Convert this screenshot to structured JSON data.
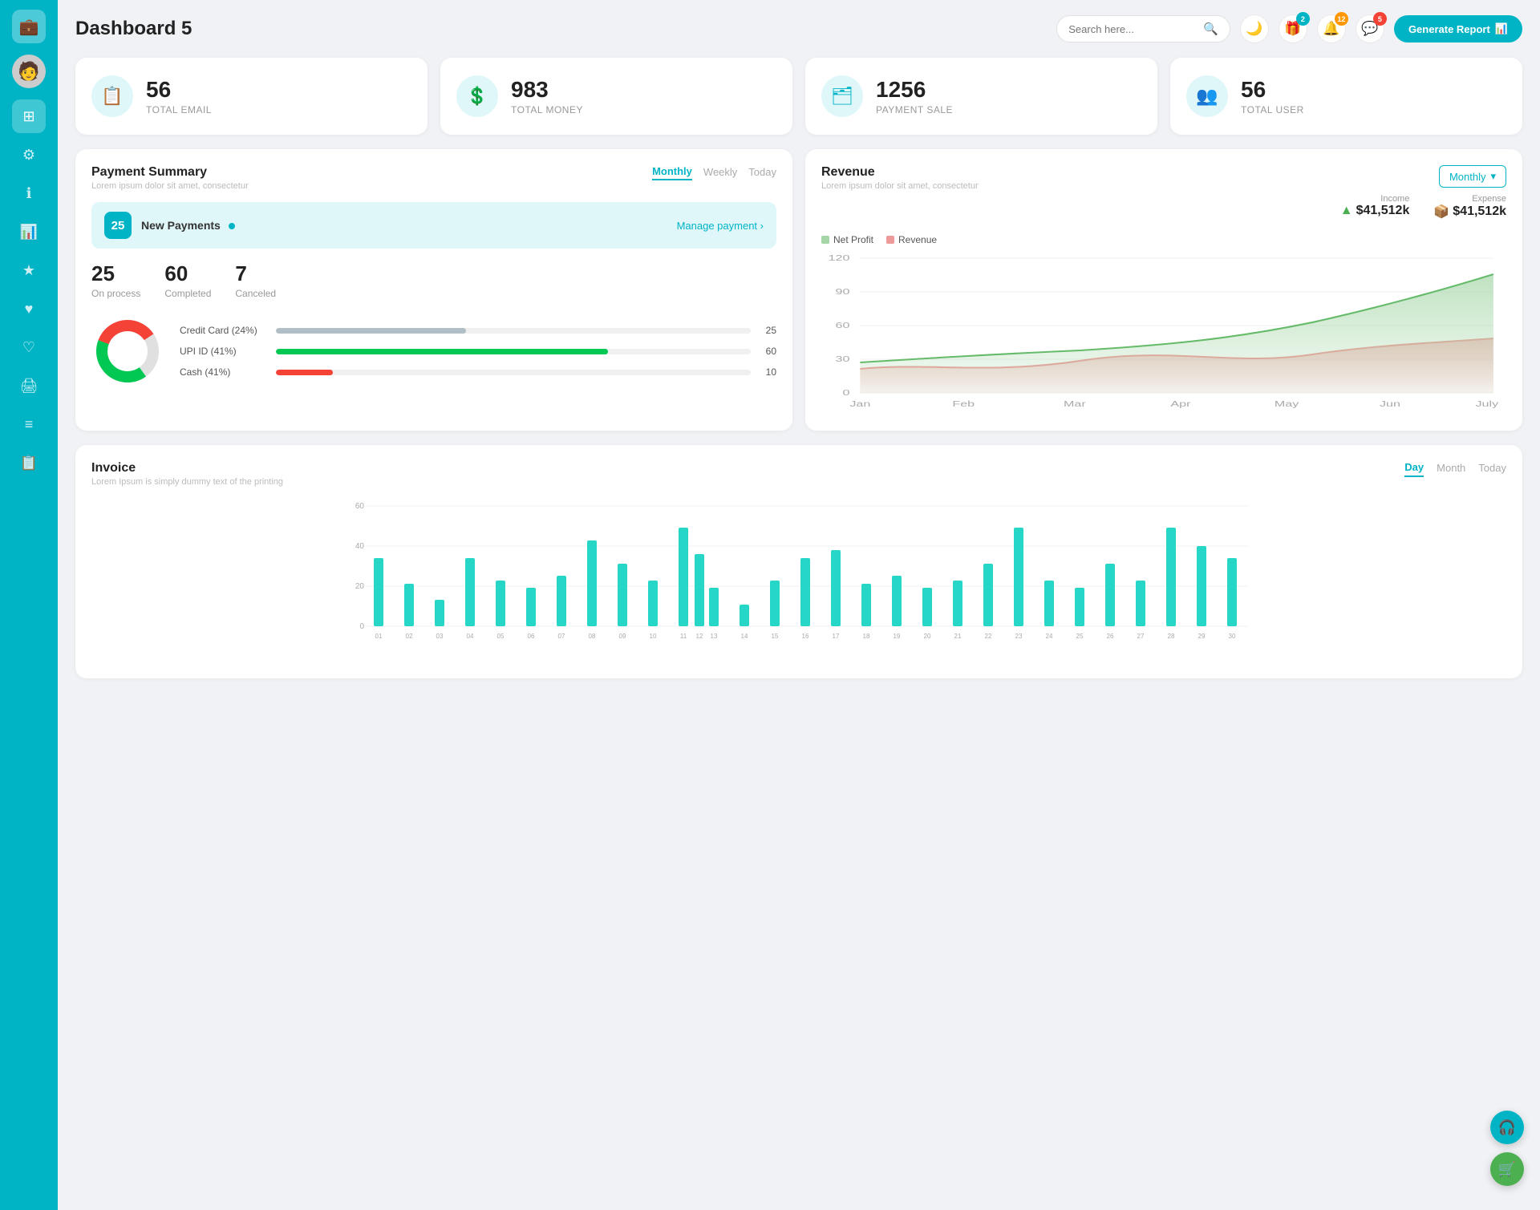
{
  "sidebar": {
    "logo_icon": "💼",
    "nav_items": [
      {
        "icon": "👤",
        "name": "avatar",
        "active": false
      },
      {
        "icon": "⊞",
        "name": "dashboard",
        "active": true
      },
      {
        "icon": "⚙",
        "name": "settings",
        "active": false
      },
      {
        "icon": "ℹ",
        "name": "info",
        "active": false
      },
      {
        "icon": "📊",
        "name": "analytics",
        "active": false
      },
      {
        "icon": "★",
        "name": "favorites",
        "active": false
      },
      {
        "icon": "♥",
        "name": "likes",
        "active": false
      },
      {
        "icon": "♡",
        "name": "wishlist",
        "active": false
      },
      {
        "icon": "🖨",
        "name": "print",
        "active": false
      },
      {
        "icon": "≡",
        "name": "menu",
        "active": false
      },
      {
        "icon": "📋",
        "name": "list",
        "active": false
      }
    ]
  },
  "header": {
    "title": "Dashboard 5",
    "search_placeholder": "Search here...",
    "generate_btn": "Generate Report",
    "badges": {
      "gift": "2",
      "bell": "12",
      "chat": "5"
    }
  },
  "stats": [
    {
      "number": "56",
      "label": "TOTAL EMAIL",
      "icon": "📋"
    },
    {
      "number": "983",
      "label": "TOTAL MONEY",
      "icon": "💲"
    },
    {
      "number": "1256",
      "label": "PAYMENT SALE",
      "icon": "🗂"
    },
    {
      "number": "56",
      "label": "TOTAL USER",
      "icon": "👥"
    }
  ],
  "payment_summary": {
    "title": "Payment Summary",
    "subtitle": "Lorem ipsum dolor sit amet, consectetur",
    "tabs": [
      "Monthly",
      "Weekly",
      "Today"
    ],
    "active_tab": "Monthly",
    "new_payments_count": "25",
    "new_payments_label": "New Payments",
    "manage_link": "Manage payment",
    "stats": [
      {
        "value": "25",
        "label": "On process"
      },
      {
        "value": "60",
        "label": "Completed"
      },
      {
        "value": "7",
        "label": "Canceled"
      }
    ],
    "bars": [
      {
        "label": "Credit Card (24%)",
        "fill": "#b0bec5",
        "percent": 40,
        "value": "25"
      },
      {
        "label": "UPI ID (41%)",
        "fill": "#00c853",
        "percent": 70,
        "value": "60"
      },
      {
        "label": "Cash (41%)",
        "fill": "#f44336",
        "percent": 12,
        "value": "10"
      }
    ],
    "donut": {
      "segments": [
        {
          "color": "#e0e0e0",
          "pct": 24
        },
        {
          "color": "#00c853",
          "pct": 41
        },
        {
          "color": "#f44336",
          "pct": 35
        }
      ]
    }
  },
  "revenue": {
    "title": "Revenue",
    "subtitle": "Lorem ipsum dolor sit amet, consectetur",
    "tab": "Monthly",
    "income_label": "Income",
    "income_value": "$41,512k",
    "expense_label": "Expense",
    "expense_value": "$41,512k",
    "legend": [
      {
        "label": "Net Profit",
        "color": "#a5d6a7"
      },
      {
        "label": "Revenue",
        "color": "#ef9a9a"
      }
    ],
    "x_labels": [
      "Jan",
      "Feb",
      "Mar",
      "Apr",
      "May",
      "Jun",
      "July"
    ],
    "y_labels": [
      "120",
      "90",
      "60",
      "30",
      "0"
    ]
  },
  "invoice": {
    "title": "Invoice",
    "subtitle": "Lorem Ipsum is simply dummy text of the printing",
    "tabs": [
      "Day",
      "Month",
      "Today"
    ],
    "active_tab": "Day",
    "y_labels": [
      "60",
      "40",
      "20",
      "0"
    ],
    "x_labels": [
      "01",
      "02",
      "03",
      "04",
      "05",
      "06",
      "07",
      "08",
      "09",
      "10",
      "11",
      "12",
      "13",
      "14",
      "15",
      "16",
      "17",
      "18",
      "19",
      "20",
      "21",
      "22",
      "23",
      "24",
      "25",
      "26",
      "27",
      "28",
      "29",
      "30"
    ],
    "bar_color": "#26d7c7"
  },
  "fabs": [
    {
      "icon": "🎧",
      "color": "teal"
    },
    {
      "icon": "🛒",
      "color": "green"
    }
  ]
}
